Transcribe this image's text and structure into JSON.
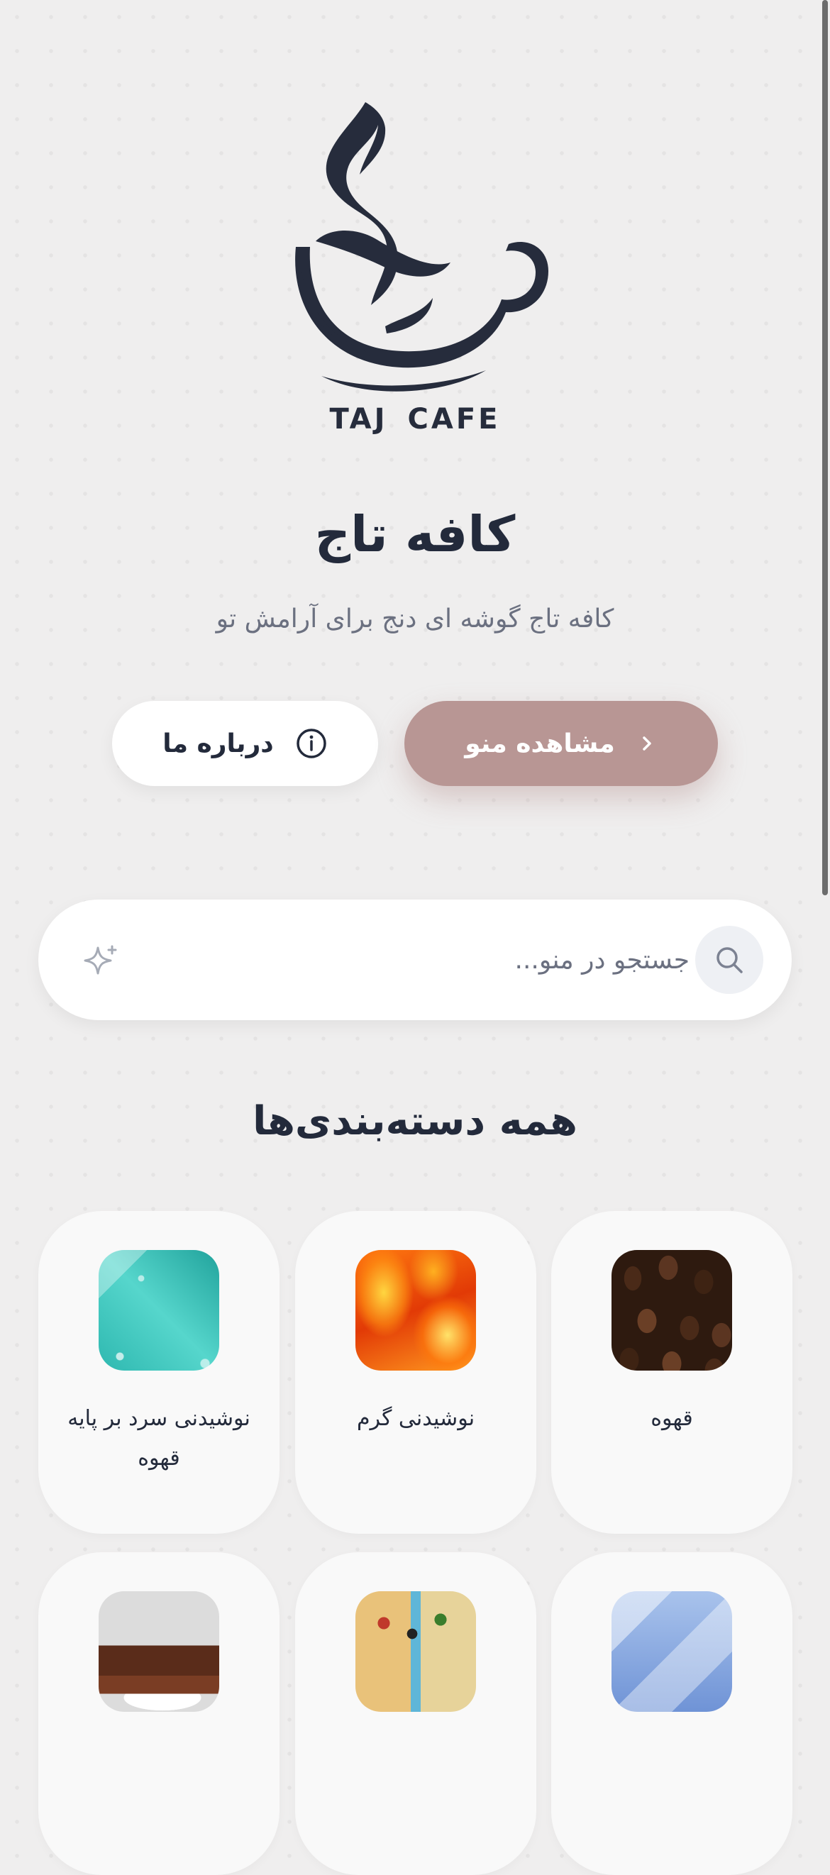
{
  "brand": {
    "logo_word_1": "TAJ",
    "logo_word_2": "CAFE",
    "logo_icon": "coffee-cup-steam-logo",
    "logo_color": "#262c3c"
  },
  "hero": {
    "title": "کافه تاج",
    "tagline": "کافه تاج گوشه ای دنج برای آرامش تو"
  },
  "buttons": {
    "view_menu": "مشاهده منو",
    "view_menu_icon": "chevron-left-icon",
    "about_us": "درباره ما",
    "about_us_icon": "info-icon",
    "accent_color": "#b89694"
  },
  "search": {
    "placeholder": "جستجو در منو...",
    "value": "",
    "icon": "search-icon",
    "extra_icon": "sparkle-icon"
  },
  "categories": {
    "title": "همه دسته‌بندی‌ها",
    "items": [
      {
        "label": "قهوه",
        "image": "coffee-beans"
      },
      {
        "label": "نوشیدنی گرم",
        "image": "fire"
      },
      {
        "label": "نوشیدنی سرد بر پایه قهوه",
        "image": "ice-water"
      },
      {
        "label": "",
        "image": "ice-cubes"
      },
      {
        "label": "",
        "image": "toast-sandwich"
      },
      {
        "label": "",
        "image": "chocolate-cake"
      }
    ]
  }
}
